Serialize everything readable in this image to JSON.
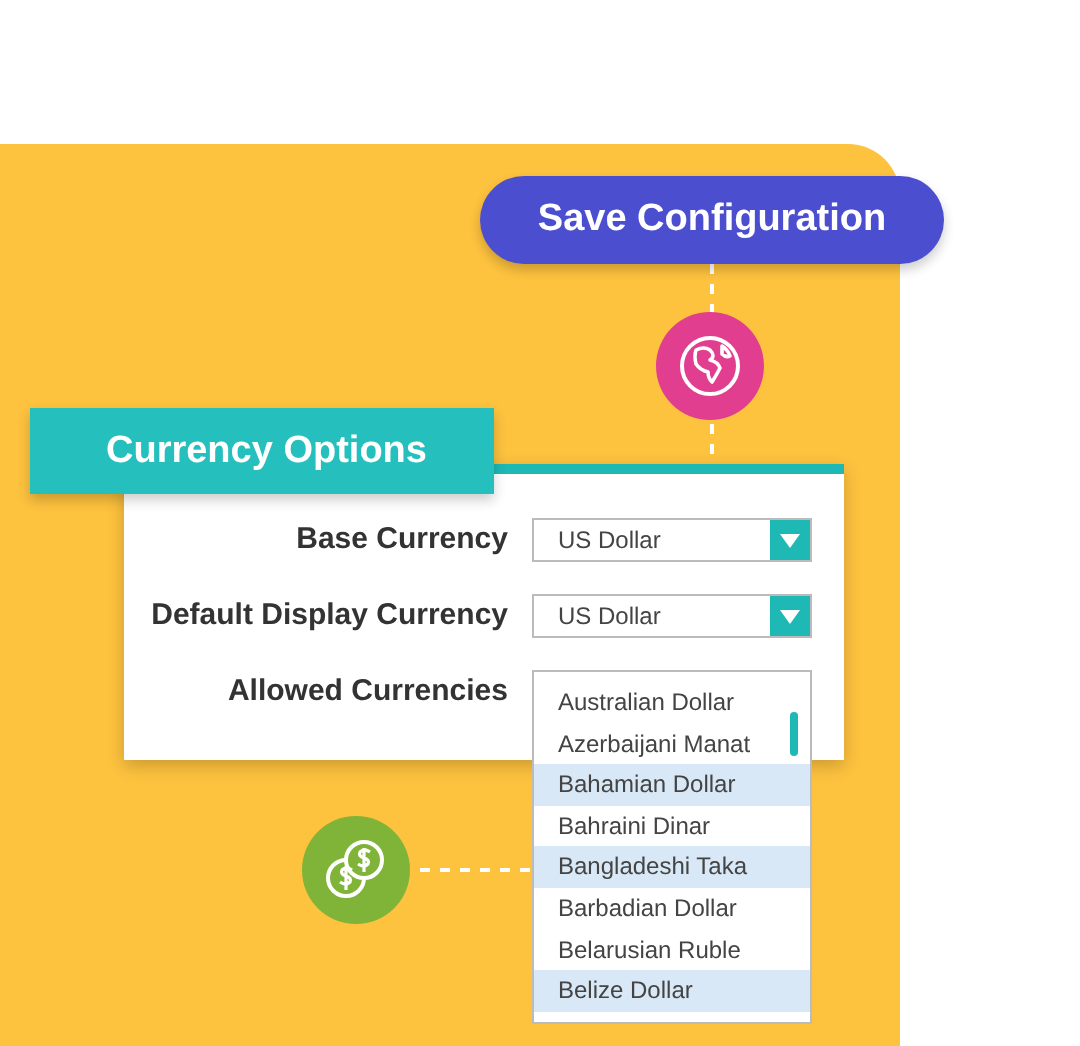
{
  "save_button": {
    "label": "Save Configuration"
  },
  "panel": {
    "title": "Currency Options",
    "fields": [
      {
        "label": "Base Currency",
        "kind": "select",
        "value": "US Dollar"
      },
      {
        "label": "Default Display Currency",
        "kind": "select",
        "value": "US Dollar"
      },
      {
        "label": "Allowed Currencies",
        "kind": "multiselect",
        "options": [
          {
            "label": "Australian Dollar",
            "selected": false
          },
          {
            "label": "Azerbaijani Manat",
            "selected": false
          },
          {
            "label": "Bahamian Dollar",
            "selected": true
          },
          {
            "label": "Bahraini Dinar",
            "selected": false
          },
          {
            "label": "Bangladeshi Taka",
            "selected": true
          },
          {
            "label": "Barbadian Dollar",
            "selected": false
          },
          {
            "label": "Belarusian Ruble",
            "selected": false
          },
          {
            "label": "Belize Dollar",
            "selected": true
          }
        ]
      }
    ]
  }
}
